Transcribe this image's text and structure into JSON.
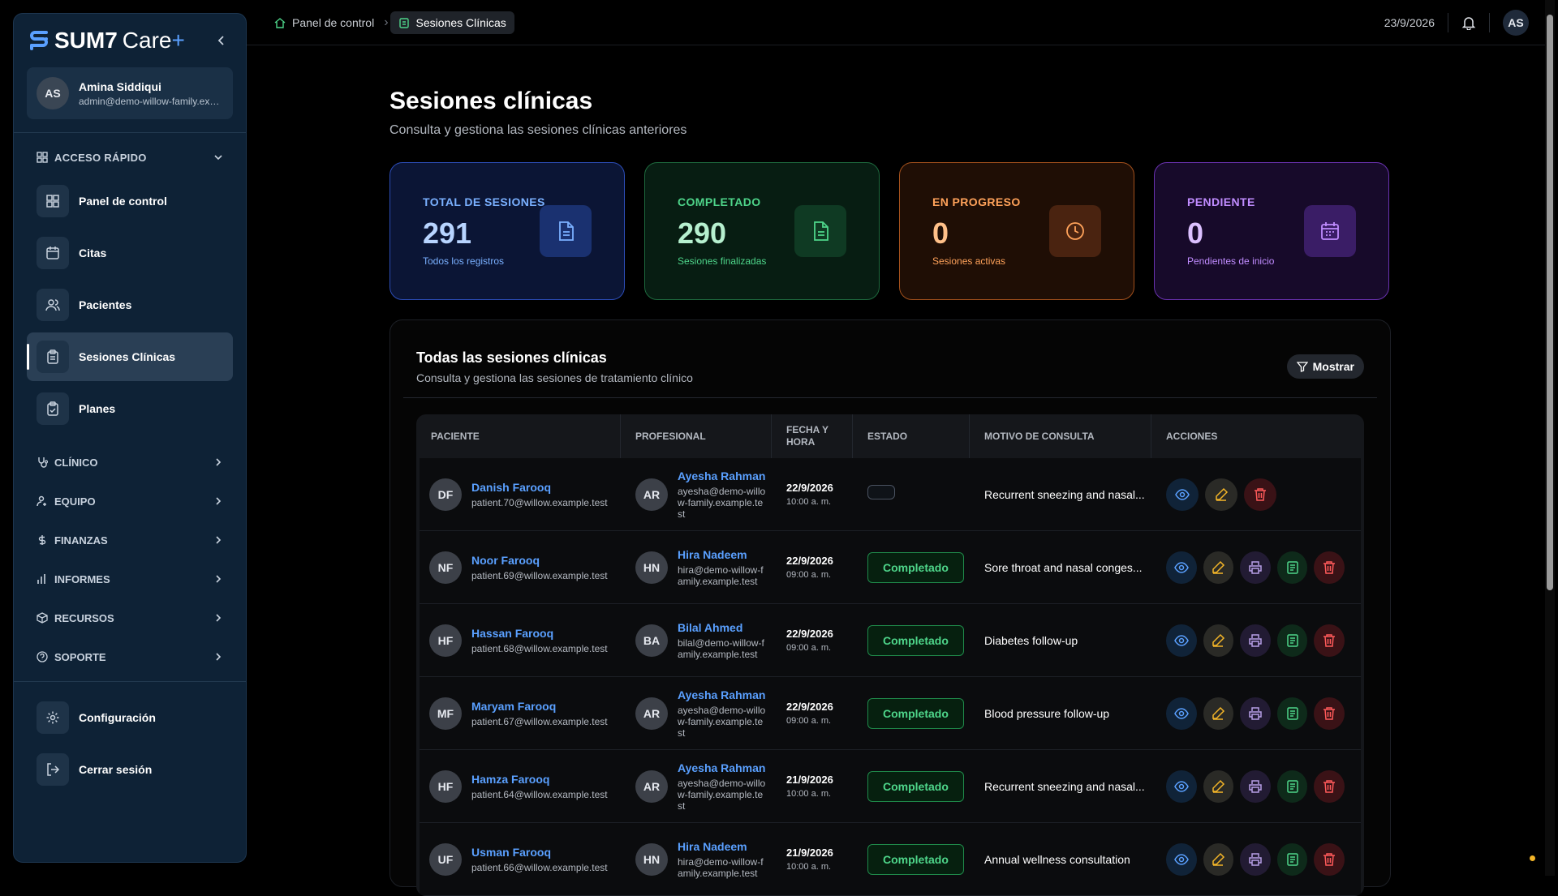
{
  "app": {
    "logo_brand": "SUM7",
    "logo_product": "Care",
    "logo_plus": "+"
  },
  "user": {
    "initials": "AS",
    "name": "Amina Siddiqui",
    "email": "admin@demo-willow-family.example.test"
  },
  "sidebar": {
    "quick_access": "ACCESO RÁPIDO",
    "items": [
      {
        "label": "Panel de control",
        "icon": "dashboard-icon"
      },
      {
        "label": "Citas",
        "icon": "calendar-icon"
      },
      {
        "label": "Pacientes",
        "icon": "users-icon"
      },
      {
        "label": "Sesiones Clínicas",
        "icon": "clipboard-icon",
        "active": true
      },
      {
        "label": "Planes",
        "icon": "clipboard-check-icon"
      }
    ],
    "groups": [
      {
        "label": "CLÍNICO",
        "icon": "stethoscope-icon"
      },
      {
        "label": "EQUIPO",
        "icon": "user-gear-icon"
      },
      {
        "label": "FINANZAS",
        "icon": "dollar-icon"
      },
      {
        "label": "INFORMES",
        "icon": "bar-chart-icon"
      },
      {
        "label": "RECURSOS",
        "icon": "box-icon"
      },
      {
        "label": "SOPORTE",
        "icon": "help-icon"
      }
    ],
    "settings": "Configuración",
    "logout": "Cerrar sesión"
  },
  "topbar": {
    "crumb_home": "Panel de control",
    "crumb_current": "Sesiones Clínicas",
    "date": "23/9/2026",
    "avatar": "AS"
  },
  "page": {
    "title": "Sesiones clínicas",
    "subtitle": "Consulta y gestiona las sesiones clínicas anteriores"
  },
  "stats": [
    {
      "label": "TOTAL DE SESIONES",
      "value": "291",
      "sub": "Todos los registros",
      "color": "#7ab0ff"
    },
    {
      "label": "COMPLETADO",
      "value": "290",
      "sub": "Sesiones finalizadas",
      "color": "#4ed58a"
    },
    {
      "label": "EN PROGRESO",
      "value": "0",
      "sub": "Sesiones activas",
      "color": "#ffa25a"
    },
    {
      "label": "PENDIENTE",
      "value": "0",
      "sub": "Pendientes de inicio",
      "color": "#c08cff"
    }
  ],
  "panel": {
    "title": "Todas las sesiones clínicas",
    "subtitle": "Consulta y gestiona las sesiones de tratamiento clínico",
    "show_button": "Mostrar"
  },
  "table": {
    "headers": [
      "PACIENTE",
      "PROFESIONAL",
      "FECHA Y HORA",
      "ESTADO",
      "MOTIVO DE CONSULTA",
      "ACCIONES"
    ],
    "rows": [
      {
        "p_init": "DF",
        "p_name": "Danish Farooq",
        "p_mail": "patient.70@willow.example.test",
        "d_init": "AR",
        "d_name": "Ayesha Rahman",
        "d_mail": "ayesha@demo-willow-family.example.test",
        "date": "22/9/2026",
        "time": "10:00 a. m.",
        "status": "",
        "reason": "Recurrent sneezing and nasal...",
        "full_actions": false
      },
      {
        "p_init": "NF",
        "p_name": "Noor Farooq",
        "p_mail": "patient.69@willow.example.test",
        "d_init": "HN",
        "d_name": "Hira Nadeem",
        "d_mail": "hira@demo-willow-family.example.test",
        "date": "22/9/2026",
        "time": "09:00 a. m.",
        "status": "Completado",
        "reason": "Sore throat and nasal conges...",
        "full_actions": true
      },
      {
        "p_init": "HF",
        "p_name": "Hassan Farooq",
        "p_mail": "patient.68@willow.example.test",
        "d_init": "BA",
        "d_name": "Bilal Ahmed",
        "d_mail": "bilal@demo-willow-family.example.test",
        "date": "22/9/2026",
        "time": "09:00 a. m.",
        "status": "Completado",
        "reason": "Diabetes follow-up",
        "full_actions": true
      },
      {
        "p_init": "MF",
        "p_name": "Maryam Farooq",
        "p_mail": "patient.67@willow.example.test",
        "d_init": "AR",
        "d_name": "Ayesha Rahman",
        "d_mail": "ayesha@demo-willow-family.example.test",
        "date": "22/9/2026",
        "time": "09:00 a. m.",
        "status": "Completado",
        "reason": "Blood pressure follow-up",
        "full_actions": true
      },
      {
        "p_init": "HF",
        "p_name": "Hamza Farooq",
        "p_mail": "patient.64@willow.example.test",
        "d_init": "AR",
        "d_name": "Ayesha Rahman",
        "d_mail": "ayesha@demo-willow-family.example.test",
        "date": "21/9/2026",
        "time": "10:00 a. m.",
        "status": "Completado",
        "reason": "Recurrent sneezing and nasal...",
        "full_actions": true
      },
      {
        "p_init": "UF",
        "p_name": "Usman Farooq",
        "p_mail": "patient.66@willow.example.test",
        "d_init": "HN",
        "d_name": "Hira Nadeem",
        "d_mail": "hira@demo-willow-family.example.test",
        "date": "21/9/2026",
        "time": "10:00 a. m.",
        "status": "Completado",
        "reason": "Annual wellness consultation",
        "full_actions": true
      }
    ]
  }
}
